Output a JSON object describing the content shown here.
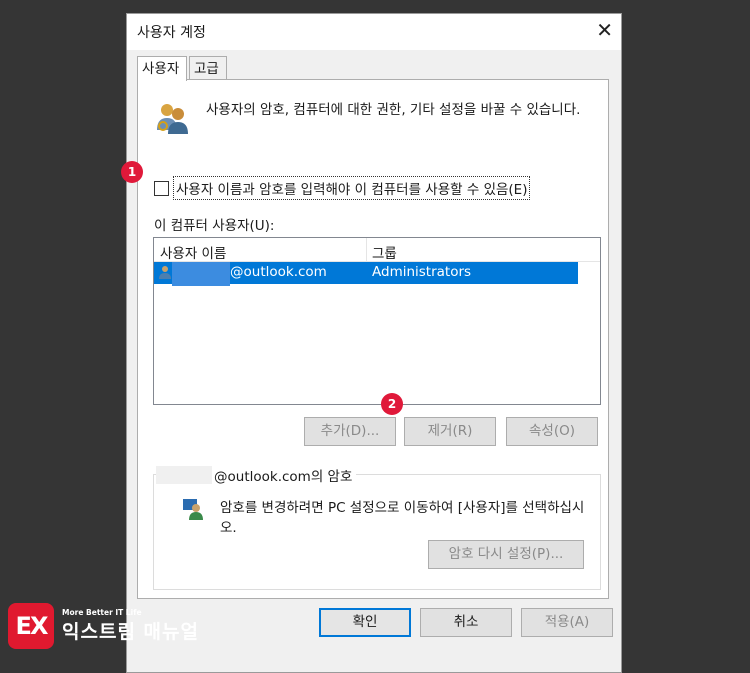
{
  "dialog": {
    "title": "사용자 계정",
    "close_glyph": "✕",
    "tabs": [
      {
        "label": "사용자",
        "active": true
      },
      {
        "label": "고급",
        "active": false
      }
    ],
    "description": "사용자의 암호, 컴퓨터에 대한 권한, 기타 설정을 바꿀 수 있습니다.",
    "require_login_checkbox": {
      "label": "사용자 이름과 암호를 입력해야 이 컴퓨터를 사용할 수 있음(E)",
      "checked": false
    },
    "users_list": {
      "label": "이 컴퓨터 사용자(U):",
      "columns": [
        "사용자 이름",
        "그룹"
      ],
      "rows": [
        {
          "user": "@outlook.com",
          "group": "Administrators",
          "selected": true
        }
      ]
    },
    "list_buttons": {
      "add": "추가(D)...",
      "remove": "제거(R)",
      "properties": "속성(O)"
    },
    "password_group": {
      "legend": "@outlook.com의 암호",
      "text": "암호를 변경하려면 PC 설정으로 이동하여 [사용자]를 선택하십시오.",
      "reset_button": "암호 다시 설정(P)..."
    },
    "footer_buttons": {
      "ok": "확인",
      "cancel": "취소",
      "apply": "적용(A)"
    }
  },
  "annotations": {
    "badge1": "1",
    "badge2": "2"
  },
  "watermark": {
    "small": "More Better IT Life",
    "big": "익스트림 매뉴얼",
    "mark": "EX"
  },
  "colors": {
    "selection": "#0078d7",
    "badge": "#e0193a",
    "desktop": "#353535"
  }
}
